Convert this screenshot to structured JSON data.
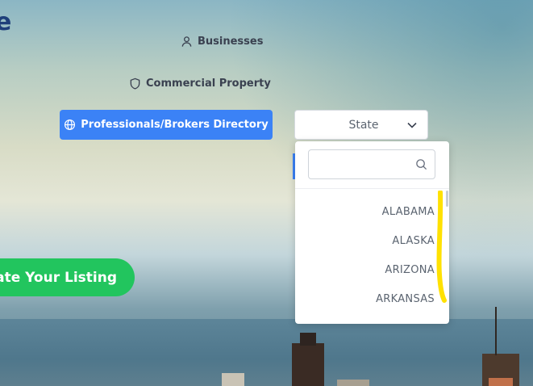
{
  "header": {
    "logo_fragment": "e"
  },
  "nav": {
    "businesses": "Businesses",
    "commercial_property": "Commercial Property",
    "professionals": "Professionals/Brokers Directory"
  },
  "state_select": {
    "value": "State",
    "search_placeholder": "",
    "options": [
      "ALABAMA",
      "ALASKA",
      "ARIZONA",
      "ARKANSAS"
    ]
  },
  "cta": {
    "label": "reate Your Listing"
  },
  "colors": {
    "primary": "#3b82f6",
    "cta": "#22c55e",
    "annotation": "#ffe100"
  }
}
